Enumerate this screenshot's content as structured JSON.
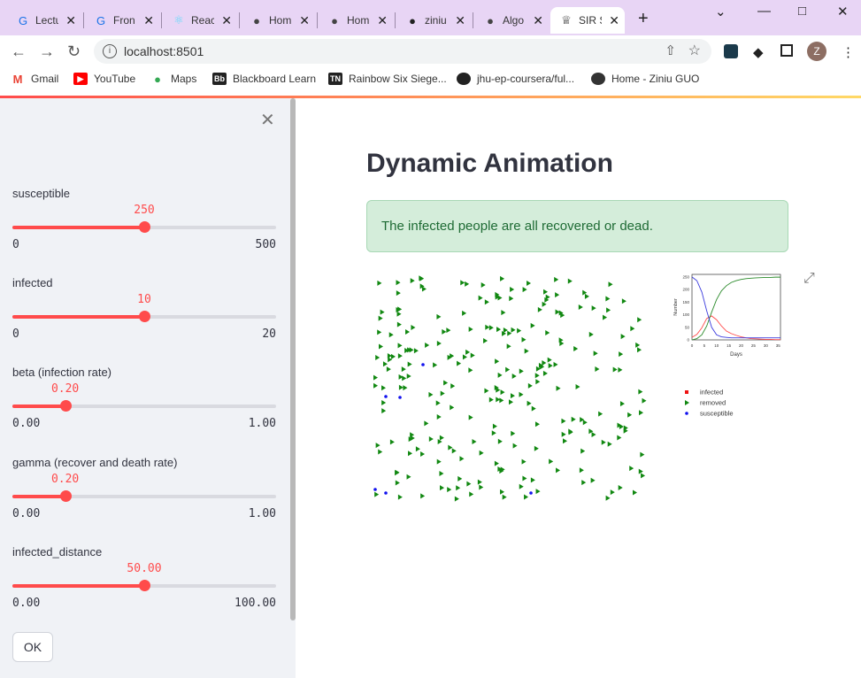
{
  "browser": {
    "tabs": [
      {
        "label": "Lectu",
        "icon": "chrome-icon",
        "active": false
      },
      {
        "label": "Fron",
        "icon": "chrome-icon",
        "active": false
      },
      {
        "label": "Reac",
        "icon": "react-icon",
        "active": false
      },
      {
        "label": "Hom",
        "icon": "globe-icon",
        "active": false
      },
      {
        "label": "Hom",
        "icon": "globe-icon",
        "active": false
      },
      {
        "label": "ziniu",
        "icon": "github-icon",
        "active": false
      },
      {
        "label": "Algo",
        "icon": "globe-icon",
        "active": false
      },
      {
        "label": "SIR S",
        "icon": "streamlit-icon",
        "active": true
      }
    ],
    "url": "localhost:8501",
    "avatar_letter": "Z",
    "bookmarks": [
      "Gmail",
      "YouTube",
      "Maps",
      "Blackboard Learn",
      "Rainbow Six Siege...",
      "jhu-ep-coursera/ful...",
      "Home - Ziniu GUO"
    ]
  },
  "sidebar": {
    "sliders": [
      {
        "label": "susceptible",
        "value": "250",
        "min": "0",
        "max": "500",
        "fraction": 0.5
      },
      {
        "label": "infected",
        "value": "10",
        "min": "0",
        "max": "20",
        "fraction": 0.5
      },
      {
        "label": "beta (infection rate)",
        "value": "0.20",
        "min": "0.00",
        "max": "1.00",
        "fraction": 0.2
      },
      {
        "label": "gamma (recover and death rate)",
        "value": "0.20",
        "min": "0.00",
        "max": "1.00",
        "fraction": 0.2
      },
      {
        "label": "infected_distance",
        "value": "50.00",
        "min": "0.00",
        "max": "100.00",
        "fraction": 0.5
      }
    ],
    "ok_label": "OK"
  },
  "main": {
    "title": "Dynamic Animation",
    "alert": "The infected people are all recovered or dead."
  },
  "chart_data": {
    "type": "line",
    "xlabel": "Days",
    "ylabel": "Number",
    "x": [
      0,
      2,
      4,
      6,
      8,
      10,
      12,
      14,
      16,
      18,
      20,
      22,
      24,
      26,
      28,
      30,
      32,
      34,
      36
    ],
    "xticks": [
      0,
      5,
      10,
      15,
      20,
      25,
      30,
      35
    ],
    "yticks": [
      0,
      50,
      100,
      150,
      200,
      250
    ],
    "ylim": [
      0,
      260
    ],
    "series": [
      {
        "name": "infected",
        "color": "#ff4b4b",
        "values": [
          10,
          22,
          48,
          85,
          95,
          80,
          55,
          35,
          25,
          18,
          12,
          8,
          5,
          4,
          3,
          2,
          2,
          1,
          1
        ]
      },
      {
        "name": "removed",
        "color": "#2a8a2a",
        "values": [
          0,
          5,
          20,
          55,
          110,
          160,
          195,
          215,
          228,
          235,
          240,
          243,
          245,
          246,
          247,
          248,
          248,
          249,
          249
        ]
      },
      {
        "name": "susceptible",
        "color": "#3b3bdd",
        "values": [
          250,
          235,
          190,
          115,
          50,
          20,
          12,
          10,
          8,
          8,
          8,
          8,
          8,
          8,
          8,
          8,
          8,
          8,
          8
        ]
      }
    ],
    "legend": [
      "infected",
      "removed",
      "susceptible"
    ],
    "legend_colors": [
      "#ee1111",
      "#118811",
      "#1111ee"
    ]
  }
}
